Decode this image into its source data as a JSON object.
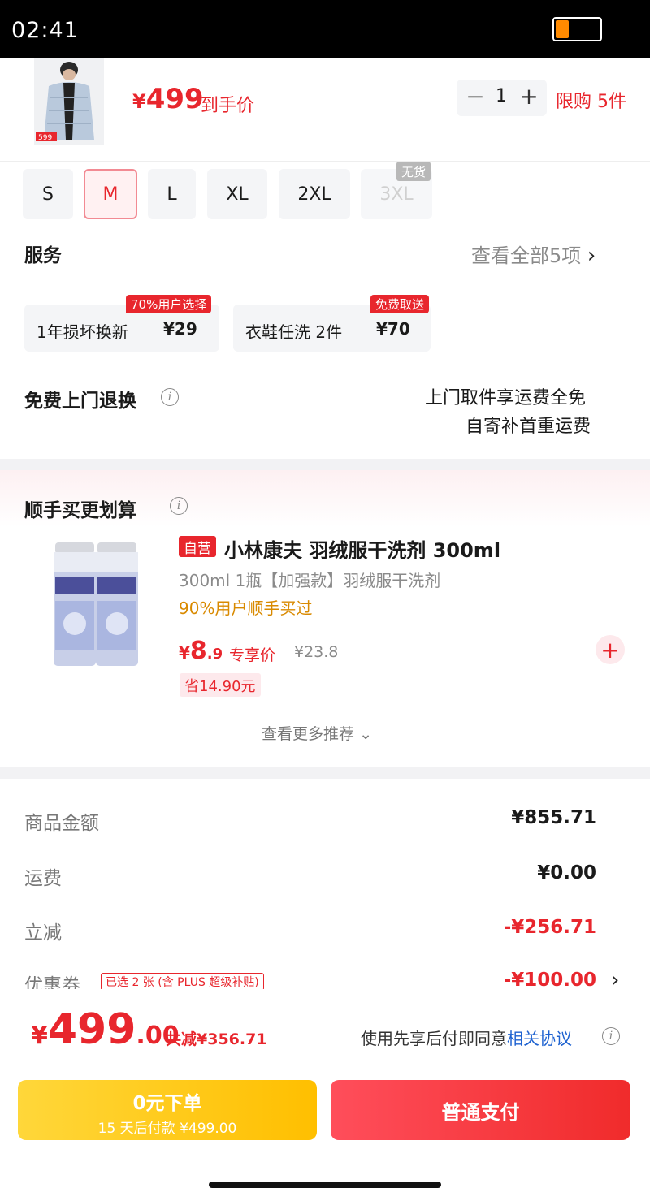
{
  "status": {
    "time": "02:41",
    "battery_icon": "battery-icon"
  },
  "product": {
    "thumb_tag": "599",
    "price_symbol": "¥",
    "price": "499",
    "price_label": "到手价",
    "quantity": "1",
    "limit": "限购 5件"
  },
  "sizes": [
    {
      "label": "S",
      "state": "normal"
    },
    {
      "label": "M",
      "state": "selected"
    },
    {
      "label": "L",
      "state": "normal"
    },
    {
      "label": "XL",
      "state": "normal"
    },
    {
      "label": "2XL",
      "state": "normal"
    },
    {
      "label": "3XL",
      "state": "disabled"
    }
  ],
  "no_stock_label": "无货",
  "service": {
    "title": "服务",
    "view_all": "查看全部5项",
    "items": [
      {
        "name": "1年损坏换新",
        "price": "¥29",
        "badge": "70%用户选择"
      },
      {
        "name": "衣鞋任洗 2件",
        "price": "¥70",
        "badge": "免费取送"
      }
    ]
  },
  "free_return": {
    "title": "免费上门退换",
    "line1": "上门取件享运费全免",
    "line2": "自寄补首重运费"
  },
  "recommend": {
    "title": "顺手买更划算",
    "self_badge": "自营",
    "name": "小林康夫 羽绒服干洗剂 300ml",
    "spec": "300ml 1瓶【加强款】羽绒服干洗剂",
    "bought": "90%用户顺手买过",
    "price_symbol": "¥",
    "price_int": "8",
    "price_dec": ".9",
    "price_label": "专享价",
    "original_price": "¥23.8",
    "save": "省14.90元",
    "more": "查看更多推荐"
  },
  "summary": {
    "goods_label": "商品金额",
    "goods_value": "¥855.71",
    "shipping_label": "运费",
    "shipping_value": "¥0.00",
    "discount_label": "立减",
    "discount_value": "-¥256.71",
    "coupon_label": "优惠券",
    "coupon_tag": "已选 2 张 (含 PLUS 超级补贴)",
    "coupon_value": "-¥100.00"
  },
  "footer": {
    "total_symbol": "¥",
    "total_int": "499",
    "total_dec": ".00",
    "total_save": "共减¥356.71",
    "agree_text": "使用先享后付即同意",
    "agree_link": "相关协议",
    "btn_zero_l1": "0元下单",
    "btn_zero_l2": "15 天后付款 ¥499.00",
    "btn_pay": "普通支付"
  },
  "colors": {
    "accent_red": "#e8262d",
    "yellow": "#ffc800",
    "link_blue": "#1e62d0"
  }
}
